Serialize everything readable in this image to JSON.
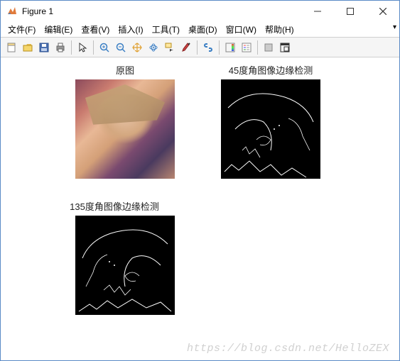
{
  "window": {
    "title": "Figure 1"
  },
  "menus": {
    "file": "文件(F)",
    "edit": "编辑(E)",
    "view": "查看(V)",
    "insert": "插入(I)",
    "tools": "工具(T)",
    "desktop": "桌面(D)",
    "window": "窗口(W)",
    "help": "帮助(H)"
  },
  "toolbar_icons": {
    "new": "new-figure",
    "open": "open",
    "save": "save",
    "print": "print",
    "pointer": "pointer",
    "zoom_in": "zoom-in",
    "zoom_out": "zoom-out",
    "pan": "pan",
    "rotate": "rotate-3d",
    "datacursor": "data-cursor",
    "brush": "brush",
    "link": "link-plots",
    "colorbar": "colorbar",
    "legend": "legend",
    "hide": "hide-tools",
    "dock": "dock"
  },
  "subplots": {
    "sp1_title": "原图",
    "sp2_title": "45度角图像边缘检测",
    "sp3_title": "135度角图像边缘检测"
  },
  "watermark": "https://blog.csdn.net/HelloZEX"
}
